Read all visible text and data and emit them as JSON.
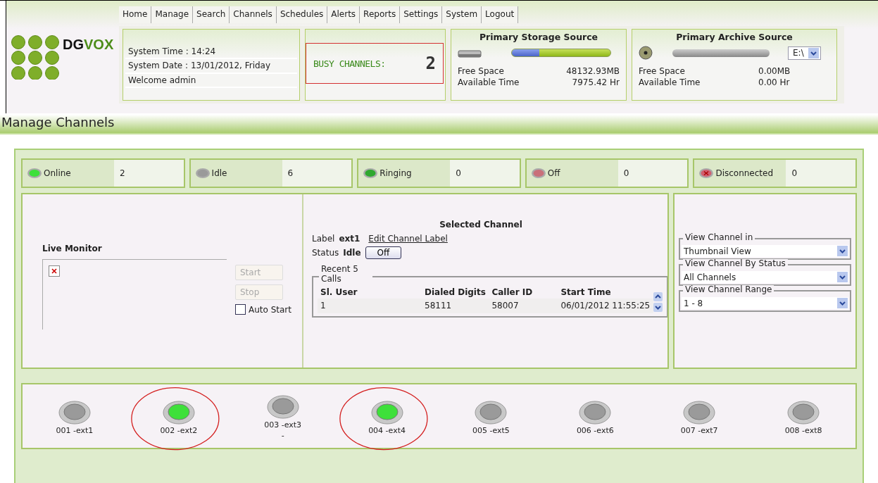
{
  "nav": [
    {
      "label": "Home"
    },
    {
      "label": "Manage"
    },
    {
      "label": "Search"
    },
    {
      "label": "Channels"
    },
    {
      "label": "Schedules"
    },
    {
      "label": "Alerts"
    },
    {
      "label": "Reports"
    },
    {
      "label": "Settings"
    },
    {
      "label": "System"
    },
    {
      "label": "Logout"
    }
  ],
  "logo": {
    "dark": "DG",
    "light": "VOX"
  },
  "system": {
    "time": "System Time : 14:24",
    "date": "System Date : 13/01/2012, Friday",
    "welcome": "Welcome admin"
  },
  "busy": {
    "label": "BUSY CHANNELS:",
    "value": "2"
  },
  "storage": {
    "title": "Primary Storage Source",
    "level": 0.28,
    "free_label": "Free Space",
    "free": "48132.93MB",
    "time_label": "Available Time",
    "time": "7975.42 Hr"
  },
  "archive": {
    "title": "Primary Archive Source",
    "drive": "E:\\",
    "free_label": "Free Space",
    "free": "0.00MB",
    "time_label": "Available Time",
    "time": "0.00 Hr"
  },
  "page_title": "Manage Channels",
  "status_counts": [
    {
      "kind": "online",
      "label": "Online",
      "count": "2"
    },
    {
      "kind": "idle",
      "label": "Idle",
      "count": "6"
    },
    {
      "kind": "ringing",
      "label": "Ringing",
      "count": "0"
    },
    {
      "kind": "off",
      "label": "Off",
      "count": "0"
    },
    {
      "kind": "disconnected",
      "label": "Disconnected",
      "count": "0"
    }
  ],
  "live_monitor": {
    "title": "Live Monitor",
    "start": "Start",
    "stop": "Stop",
    "auto_start": {
      "label": "Auto Start",
      "checked": false
    }
  },
  "selected_channel": {
    "title": "Selected Channel",
    "label_caption": "Label",
    "label": "ext1",
    "edit_link": "Edit Channel Label",
    "status_caption": "Status",
    "status": "Idle",
    "off_button": "Off",
    "recent_legend": "Recent 5 Calls",
    "columns": [
      "Sl. User",
      "Dialed Digits",
      "Caller ID",
      "Start Time"
    ],
    "rows": [
      [
        "1",
        "58111",
        "58007",
        "06/01/2012 11:55:25"
      ]
    ]
  },
  "view_options": [
    {
      "legend": "View Channel in",
      "value": "Thumbnail View"
    },
    {
      "legend": "View Channel By Status",
      "value": "All Channels"
    },
    {
      "legend": "View Channel Range",
      "value": "1 - 8"
    }
  ],
  "channels": [
    {
      "kind": "idle",
      "label": "001 -ext1",
      "circled": false
    },
    {
      "kind": "online",
      "label": "002 -ext2",
      "circled": true
    },
    {
      "kind": "idle",
      "label": "003 -ext3",
      "sub": "-",
      "circled": false
    },
    {
      "kind": "online",
      "label": "004 -ext4",
      "circled": true
    },
    {
      "kind": "idle",
      "label": "005 -ext5",
      "circled": false
    },
    {
      "kind": "idle",
      "label": "006 -ext6",
      "circled": false
    },
    {
      "kind": "idle",
      "label": "007 -ext7",
      "circled": false
    },
    {
      "kind": "idle",
      "label": "008 -ext8",
      "circled": false
    }
  ]
}
